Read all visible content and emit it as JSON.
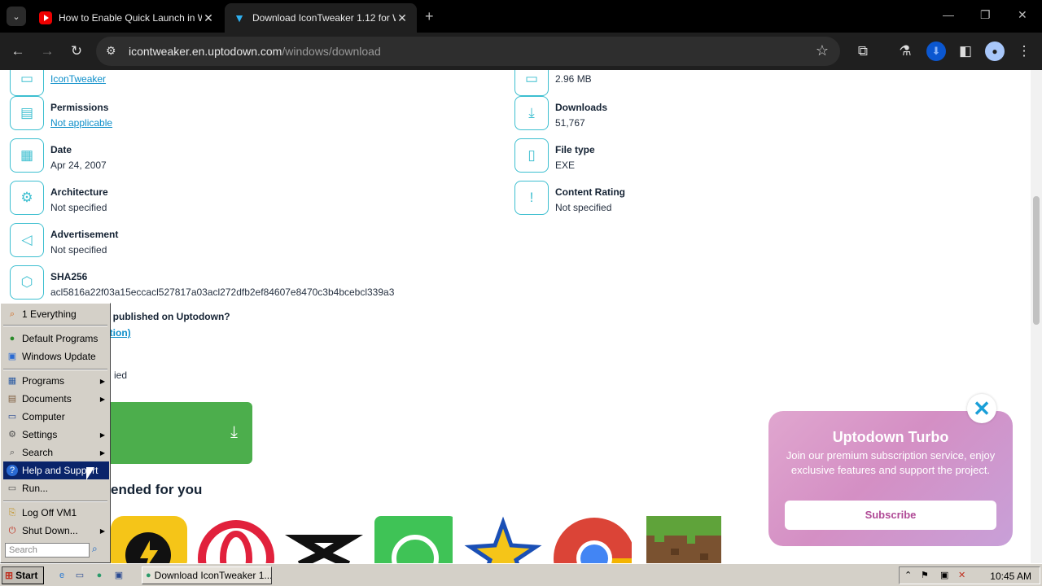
{
  "browser": {
    "tabs": [
      {
        "title": "How to Enable Quick Launch in W",
        "favicon": "youtube-icon",
        "active": false
      },
      {
        "title": "Download IconTweaker 1.12 for W",
        "favicon": "uptodown-icon",
        "active": true
      }
    ],
    "url_host": "icontweaker.en.uptodown.com",
    "url_path": "/windows/download"
  },
  "info_left": [
    {
      "key": "author",
      "label": "",
      "value": "IconTweaker",
      "is_link": true,
      "icon": "author-icon"
    },
    {
      "key": "permissions",
      "label": "Permissions",
      "value": "Not applicable",
      "is_link": true,
      "icon": "permissions-icon"
    },
    {
      "key": "date",
      "label": "Date",
      "value": "Apr 24, 2007",
      "is_link": false,
      "icon": "calendar-icon"
    },
    {
      "key": "architecture",
      "label": "Architecture",
      "value": "Not specified",
      "is_link": false,
      "icon": "chip-icon"
    },
    {
      "key": "advertisement",
      "label": "Advertisement",
      "value": "Not specified",
      "is_link": false,
      "icon": "megaphone-icon"
    },
    {
      "key": "sha256",
      "label": "SHA256",
      "value": "acl5816a22f03a15eccacl527817a03acl272dfb2ef84607e8470c3b4bcebcl339a3",
      "is_link": false,
      "icon": "shield-icon"
    }
  ],
  "info_right": [
    {
      "key": "size",
      "label": "",
      "value": "2.96 MB",
      "icon": "size-icon"
    },
    {
      "key": "downloads",
      "label": "Downloads",
      "value": "51,767",
      "icon": "download-count-icon"
    },
    {
      "key": "filetype",
      "label": "File type",
      "value": "EXE",
      "icon": "file-icon"
    },
    {
      "key": "rating",
      "label": "Content Rating",
      "value": "Not specified",
      "icon": "rating-icon"
    }
  ],
  "question": "p published on Uptodown?",
  "report_link": "ation)",
  "partial_text": "ied",
  "recommended_title": "ended for you",
  "promo": {
    "title": "Uptodown Turbo",
    "description": "Join our premium subscription service, enjoy exclusive features and support the project.",
    "button": "Subscribe"
  },
  "start_menu": {
    "pinned": [
      "1 Everything"
    ],
    "items_top": [
      "Default Programs",
      "Windows Update"
    ],
    "items_main": [
      {
        "label": "Programs",
        "submenu": true
      },
      {
        "label": "Documents",
        "submenu": true
      },
      {
        "label": "Computer",
        "submenu": false
      },
      {
        "label": "Settings",
        "submenu": true
      },
      {
        "label": "Search",
        "submenu": true
      },
      {
        "label": "Help and Support",
        "submenu": false,
        "highlighted": true
      },
      {
        "label": "Run...",
        "submenu": false
      }
    ],
    "items_bottom": [
      {
        "label": "Log Off VM1",
        "submenu": false
      },
      {
        "label": "Shut Down...",
        "submenu": true
      }
    ],
    "search_placeholder": "Search"
  },
  "taskbar": {
    "start_label": "Start",
    "task_title": "Download IconTweaker 1...",
    "clock": "10:45 AM"
  }
}
